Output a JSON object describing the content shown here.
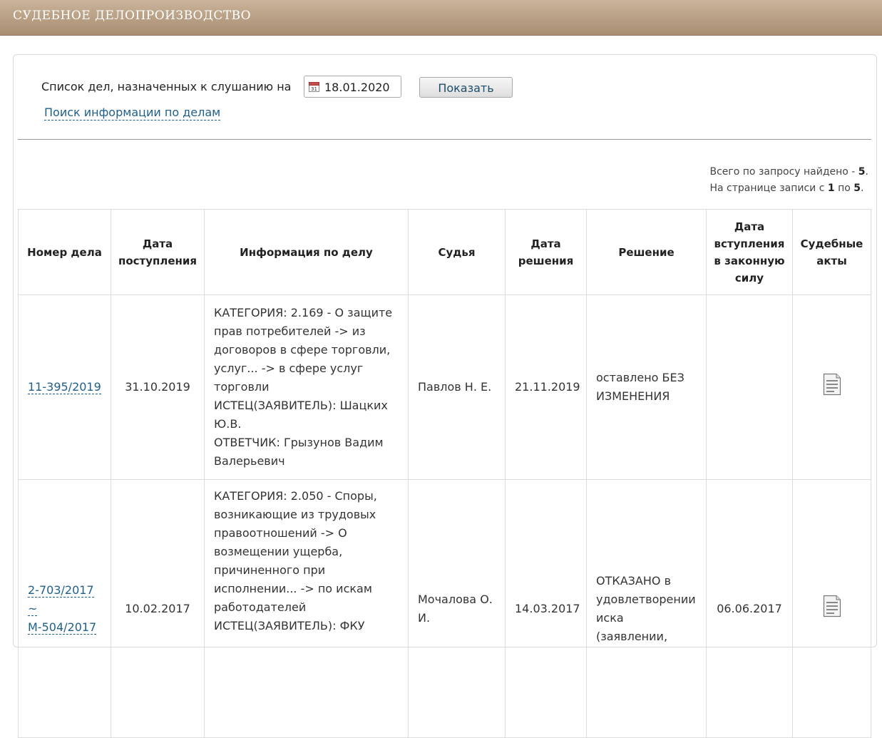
{
  "header": {
    "title": "СУДЕБНОЕ ДЕЛОПРОИЗВОДСТВО"
  },
  "filter": {
    "label": "Список дел, назначенных к слушанию на",
    "date_value": "18.01.2020",
    "show_button": "Показать",
    "search_link": "Поиск информации по делам"
  },
  "summary": {
    "found_prefix": "Всего по запросу найдено - ",
    "found_count": "5",
    "page_prefix": "На странице записи с ",
    "page_from": "1",
    "page_mid": " по ",
    "page_to": "5"
  },
  "table": {
    "headers": {
      "case_number": "Номер дела",
      "received_date": "Дата поступления",
      "info": "Информация по делу",
      "judge": "Судья",
      "decision_date": "Дата решения",
      "decision": "Решение",
      "effective_date": "Дата вступления в законную силу",
      "acts": "Судебные акты"
    },
    "rows": [
      {
        "case_number": "11-395/2019",
        "received_date": "31.10.2019",
        "info": [
          "КАТЕГОРИЯ: 2.169 - О защите",
          "прав потребителей -> из",
          "договоров в сфере торговли,",
          "услуг... -> в сфере услуг",
          "торговли",
          "ИСТЕЦ(ЗАЯВИТЕЛЬ): Шацких",
          "Ю.В.",
          "ОТВЕТЧИК: Грызунов Вадим",
          "Валерьевич"
        ],
        "judge": "Павлов Н. Е.",
        "decision_date": "21.11.2019",
        "decision": "оставлено БЕЗ ИЗМЕНЕНИЯ",
        "effective_date": "",
        "act_icon": "document-icon"
      },
      {
        "case_number": "2-703/2017 ~ М-504/2017",
        "received_date": "10.02.2017",
        "info": [
          "КАТЕГОРИЯ: 2.050 - Споры,",
          "возникающие из трудовых",
          "правоотношений -> О",
          "возмещении ущерба,",
          "причиненного при",
          "исполнении... -> по искам",
          "работодателей",
          "ИСТЕЦ(ЗАЯВИТЕЛЬ): ФКУ"
        ],
        "judge": "Мочалова О. И.",
        "decision_date": "14.03.2017",
        "decision": "ОТКАЗАНО в удовлетворении иска (заявлении,",
        "effective_date": "06.06.2017",
        "act_icon": "document-icon"
      }
    ]
  },
  "colors": {
    "header_bar": "#b49b80",
    "link": "#1e5f8c"
  }
}
